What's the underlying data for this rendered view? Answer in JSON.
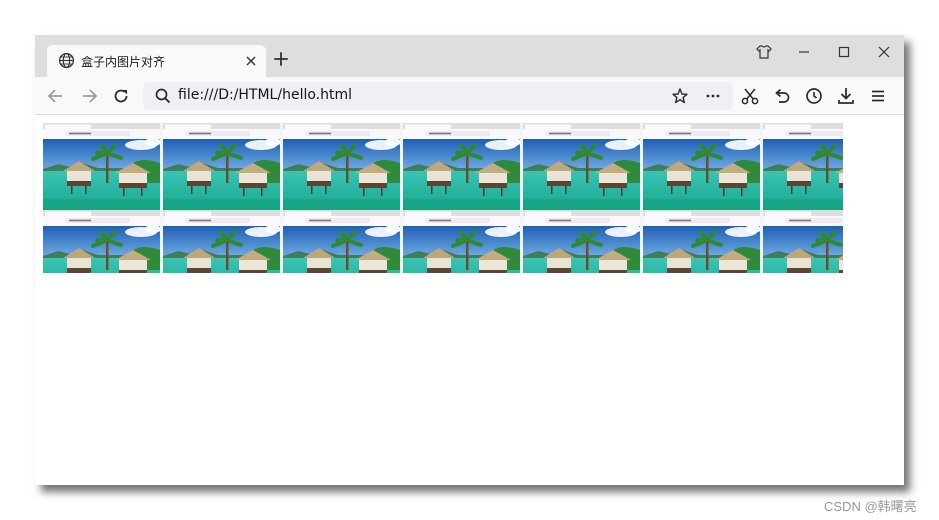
{
  "browser": {
    "tab": {
      "title": "盒子内图片对齐",
      "icon": "globe-icon"
    },
    "address": {
      "url": "file:///D:/HTML/hello.html"
    },
    "colors": {
      "titlebar": "#dedede",
      "toolbar": "#f9f9fb",
      "urlbar": "#f0f0f4"
    }
  },
  "content": {
    "image_rows": 2,
    "images_per_row": 7,
    "mini_tab_title": "盒子内图片对齐",
    "mini_url": "file:///D:/HTML/hello.html"
  },
  "watermark": {
    "text": "CSDN @韩曙亮"
  }
}
